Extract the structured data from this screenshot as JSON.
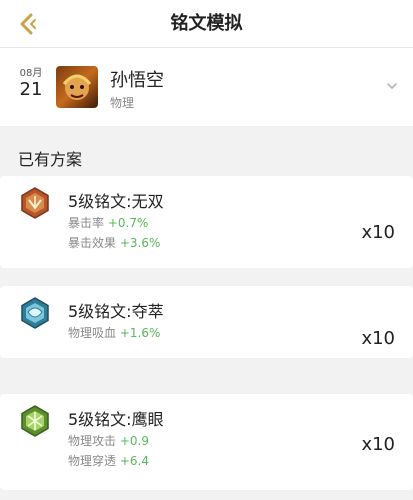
{
  "header": {
    "title": "铭文模拟",
    "back_icon": "back-chevron-icon"
  },
  "hero": {
    "date_month": "08月",
    "date_day": "21",
    "name": "孙悟空",
    "type": "物理",
    "dropdown_icon": "chevron-down-icon"
  },
  "section": {
    "label": "已有方案"
  },
  "runes": [
    {
      "name": "5级铭文:无双",
      "icon": "red-rune-icon",
      "color": "#c45a2a",
      "stats": [
        {
          "label": "暴击率",
          "value": "+0.7%"
        },
        {
          "label": "暴击效果",
          "value": "+3.6%"
        }
      ],
      "count": "x10"
    },
    {
      "name": "5级铭文:夺萃",
      "icon": "blue-rune-icon",
      "color": "#3b97b5",
      "stats": [
        {
          "label": "物理吸血",
          "value": "+1.6%"
        }
      ],
      "count": "x10"
    },
    {
      "name": "5级铭文:鹰眼",
      "icon": "green-rune-icon",
      "color": "#6aa33a",
      "stats": [
        {
          "label": "物理攻击",
          "value": "+0.9"
        },
        {
          "label": "物理穿透",
          "value": "+6.4"
        }
      ],
      "count": "x10"
    }
  ]
}
